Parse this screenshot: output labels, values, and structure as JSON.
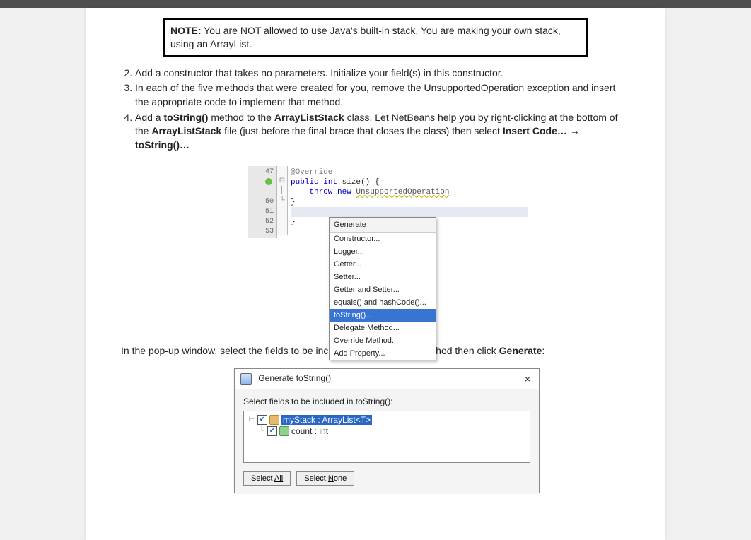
{
  "note": {
    "label": "NOTE:",
    "text": "  You are NOT allowed to use Java's built-in stack. You are making your own stack, using an ArrayList."
  },
  "steps": {
    "s2": "Add a constructor that takes no parameters.  Initialize your field(s) in this constructor.",
    "s3": "In each of the five methods that were created for you, remove the UnsupportedOperation exception and insert the appropriate code to implement that method.",
    "s4a": "Add a ",
    "s4b": "toString()",
    "s4c": " method to the ",
    "s4d": "ArrayListStack",
    "s4e": " class.  Let NetBeans help you by right-clicking at the bottom of the ",
    "s4f": "ArrayListStack",
    "s4g": " file (just before the final brace that closes the class) then select ",
    "s4h": "Insert Code… → toString()…"
  },
  "editor": {
    "ln47": "47",
    "ln50": "50",
    "ln51": "51",
    "ln52": "52",
    "ln53": "53",
    "code_override": "@Override",
    "code_sig_kw1": "public ",
    "code_sig_kw2": "int ",
    "code_sig_name": "size() {",
    "code_throw_kw": "throw new ",
    "code_throw_ex": "UnsupportedOperation",
    "code_close1": "}",
    "code_close2": "}"
  },
  "ctx": {
    "header": "Generate",
    "items": [
      "Constructor...",
      "Logger...",
      "Getter...",
      "Setter...",
      "Getter and Setter...",
      "equals() and hashCode()...",
      "toString()...",
      "Delegate Method...",
      "Override Method...",
      "Add Property..."
    ],
    "selected_index": 6
  },
  "mid_para_a": "In the pop-up window, select the fields to be included in the toString method then click ",
  "mid_para_b": "Generate",
  "mid_para_c": ":",
  "dialog": {
    "title": "Generate toString()",
    "label": "Select fields to be included in toString():",
    "field1": "myStack : ArrayList<T>",
    "field2": "count : int",
    "btn_all": "All",
    "btn_all_prefix": "Select ",
    "btn_none": "one",
    "btn_none_full": "Select None",
    "close": "×"
  }
}
